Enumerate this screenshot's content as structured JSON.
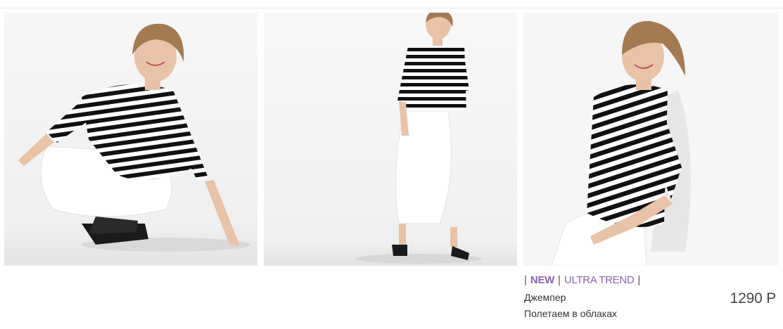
{
  "product": {
    "badges": {
      "separator": "|",
      "new_label": "NEW",
      "trend_label": "ULTRA TREND"
    },
    "type": "Джемпер",
    "name": "Полетаем в облаках",
    "price": "1290 Р"
  },
  "colors": {
    "badge": "#8b63ad",
    "text": "#333333",
    "stripe_dark": "#111111",
    "skirt": "#ffffff",
    "photo_bg": "#f3f3f3"
  },
  "gallery": {
    "photos": [
      {
        "id": "photo-1",
        "pose": "crouching"
      },
      {
        "id": "photo-2",
        "pose": "standing"
      },
      {
        "id": "photo-3",
        "pose": "half-turn"
      }
    ]
  }
}
